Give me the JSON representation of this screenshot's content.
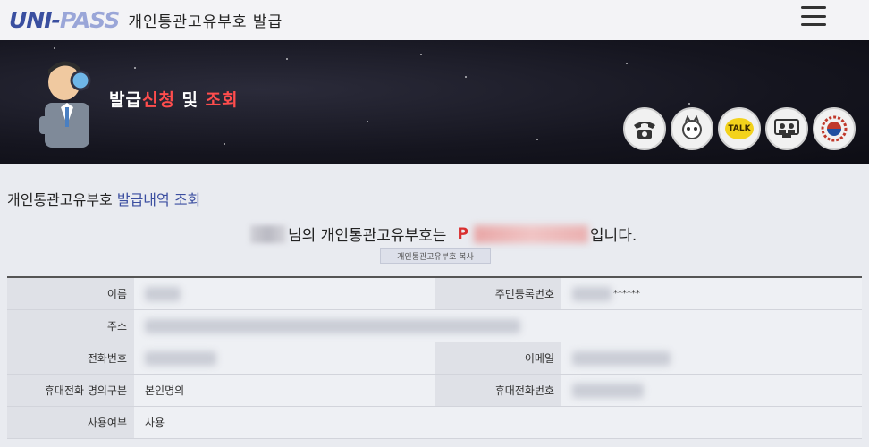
{
  "header": {
    "logo_main": "UNI-",
    "logo_accent": "PASS",
    "title": "개인통관고유부호 발급"
  },
  "banner": {
    "title_part1": "발급",
    "title_part2": "신청",
    "title_part3": " 및 ",
    "title_part4": "조회",
    "icons": [
      "phone-icon",
      "mascot-icon",
      "talk-icon",
      "remote-support-icon",
      "government-seal-icon"
    ],
    "talk_label": "TALK"
  },
  "content": {
    "section_title_part1": "개인통관고유부호 ",
    "section_title_part2": "발급내역 조회",
    "message_part1": "님의 개인통관고유부호는",
    "message_pass_prefix": "P",
    "message_part2": "입니다.",
    "copy_button": "개인통관고유부호 복사"
  },
  "info_table": {
    "name_label": "이름",
    "rrn_label": "주민등록번호",
    "rrn_value": "******",
    "address_label": "주소",
    "phone_label": "전화번호",
    "email_label": "이메일",
    "mobile_type_label": "휴대전화 명의구분",
    "mobile_type_value": "본인명의",
    "mobile_label": "휴대전화번호",
    "usage_label": "사용여부",
    "usage_value": "사용"
  },
  "colors": {
    "accent_blue": "#3b4ea0",
    "accent_red": "#d93030",
    "banner_bg": "#15151f"
  }
}
